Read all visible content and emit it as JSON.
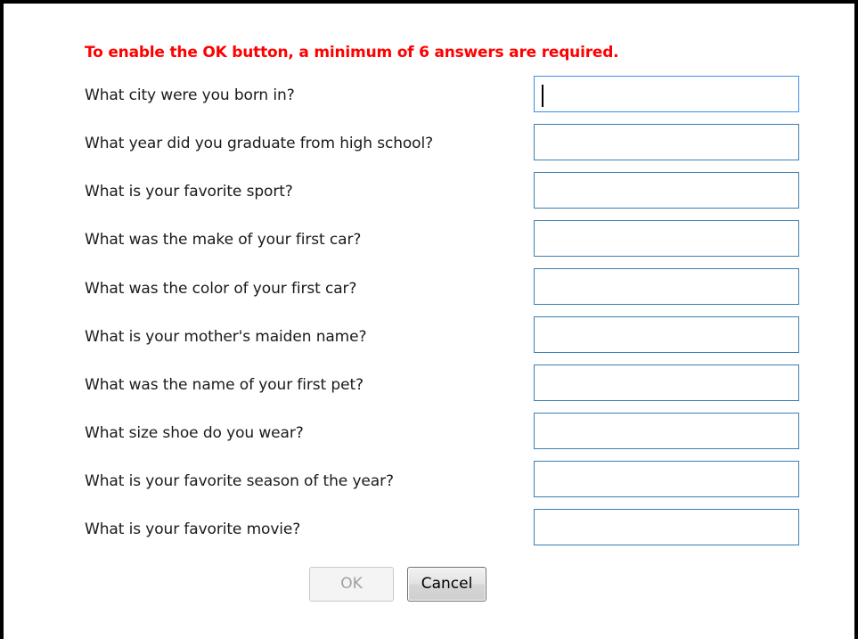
{
  "dialog": {
    "warning": "To enable the OK button, a minimum of 6 answers are required.",
    "questions": [
      {
        "label": "What city were you born in?",
        "value": ""
      },
      {
        "label": "What year did you graduate from high school?",
        "value": ""
      },
      {
        "label": "What is your favorite sport?",
        "value": ""
      },
      {
        "label": "What was the make of your first car?",
        "value": ""
      },
      {
        "label": "What was the color of your first car?",
        "value": ""
      },
      {
        "label": "What is your mother's maiden name?",
        "value": ""
      },
      {
        "label": "What was the name of your first pet?",
        "value": ""
      },
      {
        "label": "What size shoe do you wear?",
        "value": ""
      },
      {
        "label": "What is your favorite season of the year?",
        "value": ""
      },
      {
        "label": "What is your favorite movie?",
        "value": ""
      }
    ],
    "buttons": {
      "ok_label": "OK",
      "ok_enabled": false,
      "cancel_label": "Cancel"
    },
    "colors": {
      "warning": "#ff0000",
      "input_border": "#3c7fb1",
      "frame_border": "#000000"
    }
  }
}
